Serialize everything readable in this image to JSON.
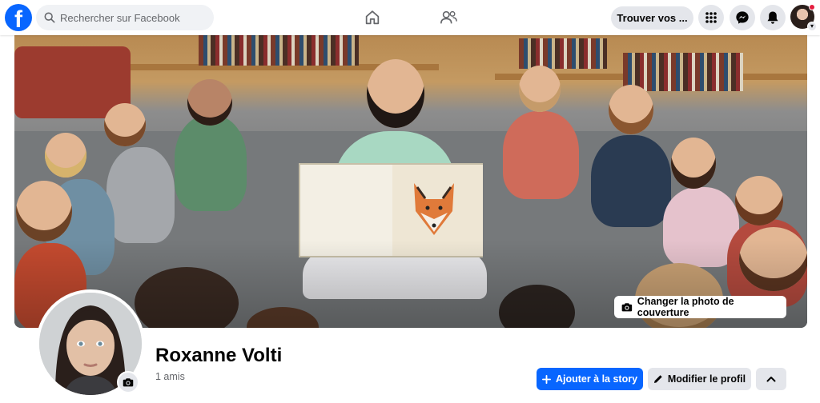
{
  "colors": {
    "brand": "#0866ff",
    "surface": "#e4e6eb",
    "text_secondary": "#65676b",
    "notification": "#e41e3f"
  },
  "topbar": {
    "logo_icon": "facebook-logo-icon",
    "logo_letter": "f",
    "search": {
      "placeholder": "Rechercher sur Facebook",
      "value": "",
      "icon": "search-icon"
    },
    "nav": [
      {
        "name": "home",
        "icon": "home-icon"
      },
      {
        "name": "friends",
        "icon": "friends-icon"
      }
    ],
    "find_friends_label": "Trouver vos ...",
    "actions": [
      {
        "name": "menu",
        "icon": "grid-menu-icon"
      },
      {
        "name": "messenger",
        "icon": "messenger-icon"
      },
      {
        "name": "notifications",
        "icon": "bell-icon"
      }
    ],
    "account_icon": "avatar"
  },
  "cover": {
    "change_cover_label": "Changer la photo de couverture",
    "camera_icon": "camera-icon"
  },
  "profile": {
    "name": "Roxanne Volti",
    "friends_count": "1 amis",
    "camera_icon": "camera-icon"
  },
  "actions": {
    "add_story_label": "Ajouter à la story",
    "add_story_icon": "plus-icon",
    "edit_profile_label": "Modifier le profil",
    "edit_profile_icon": "pencil-icon",
    "more_icon": "chevron-up-icon"
  }
}
